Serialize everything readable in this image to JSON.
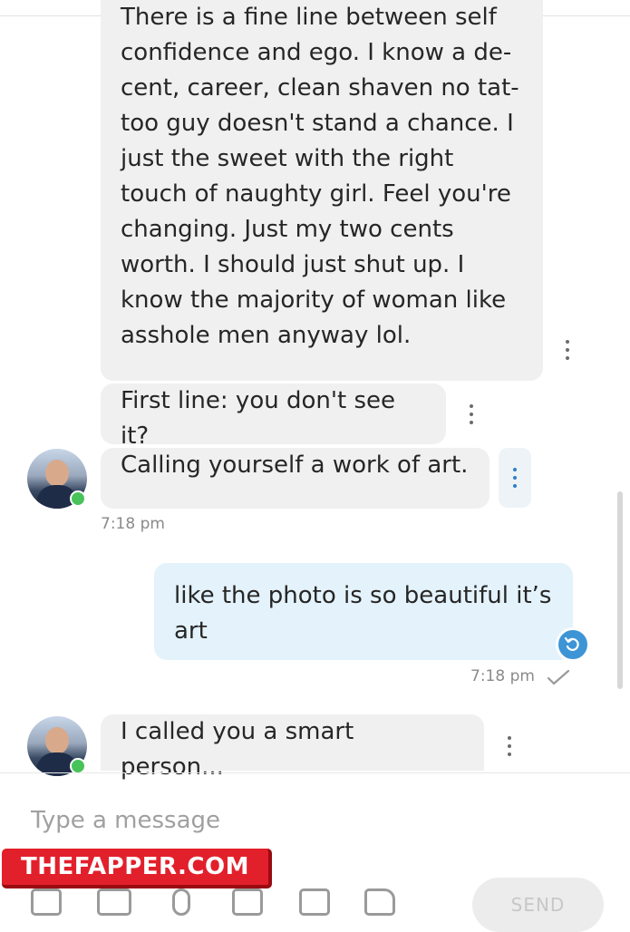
{
  "conversation": {
    "messages": [
      {
        "direction": "incoming",
        "text_lines": [
          "There is a fine line between self",
          "confidence and ego. I know a de-",
          "cent, career, clean shaven no tat-",
          "too guy doesn't stand a chance. I",
          "just the sweet with the right",
          "touch of naughty girl. Feel you're",
          "changing. Just my two cents",
          "worth. I should just shut up. I",
          "know the majority of woman like",
          "asshole men anyway lol."
        ]
      },
      {
        "direction": "incoming",
        "text": "First line: you don't see it?"
      },
      {
        "direction": "incoming",
        "text": "Calling yourself a work of art.",
        "time": "7:18 pm"
      },
      {
        "direction": "outgoing",
        "text_lines": [
          "like the photo is so beautiful it’s",
          "art"
        ],
        "time": "7:18 pm",
        "status_icon": "check-icon"
      },
      {
        "direction": "incoming",
        "text": "I called you a smart person..."
      }
    ]
  },
  "composer": {
    "placeholder": "Type a message",
    "send_label": "SEND",
    "icons": [
      "image-icon",
      "video-icon",
      "microphone-icon",
      "gift-icon",
      "calendar-icon",
      "tag-icon"
    ]
  },
  "watermark": {
    "text": "THEFAPPER.COM"
  },
  "colors": {
    "incoming_bubble": "#f0f0f0",
    "outgoing_bubble": "#e4f2fb",
    "accent": "#3d95d6",
    "online": "#48c35a",
    "watermark": "#e2202b"
  }
}
